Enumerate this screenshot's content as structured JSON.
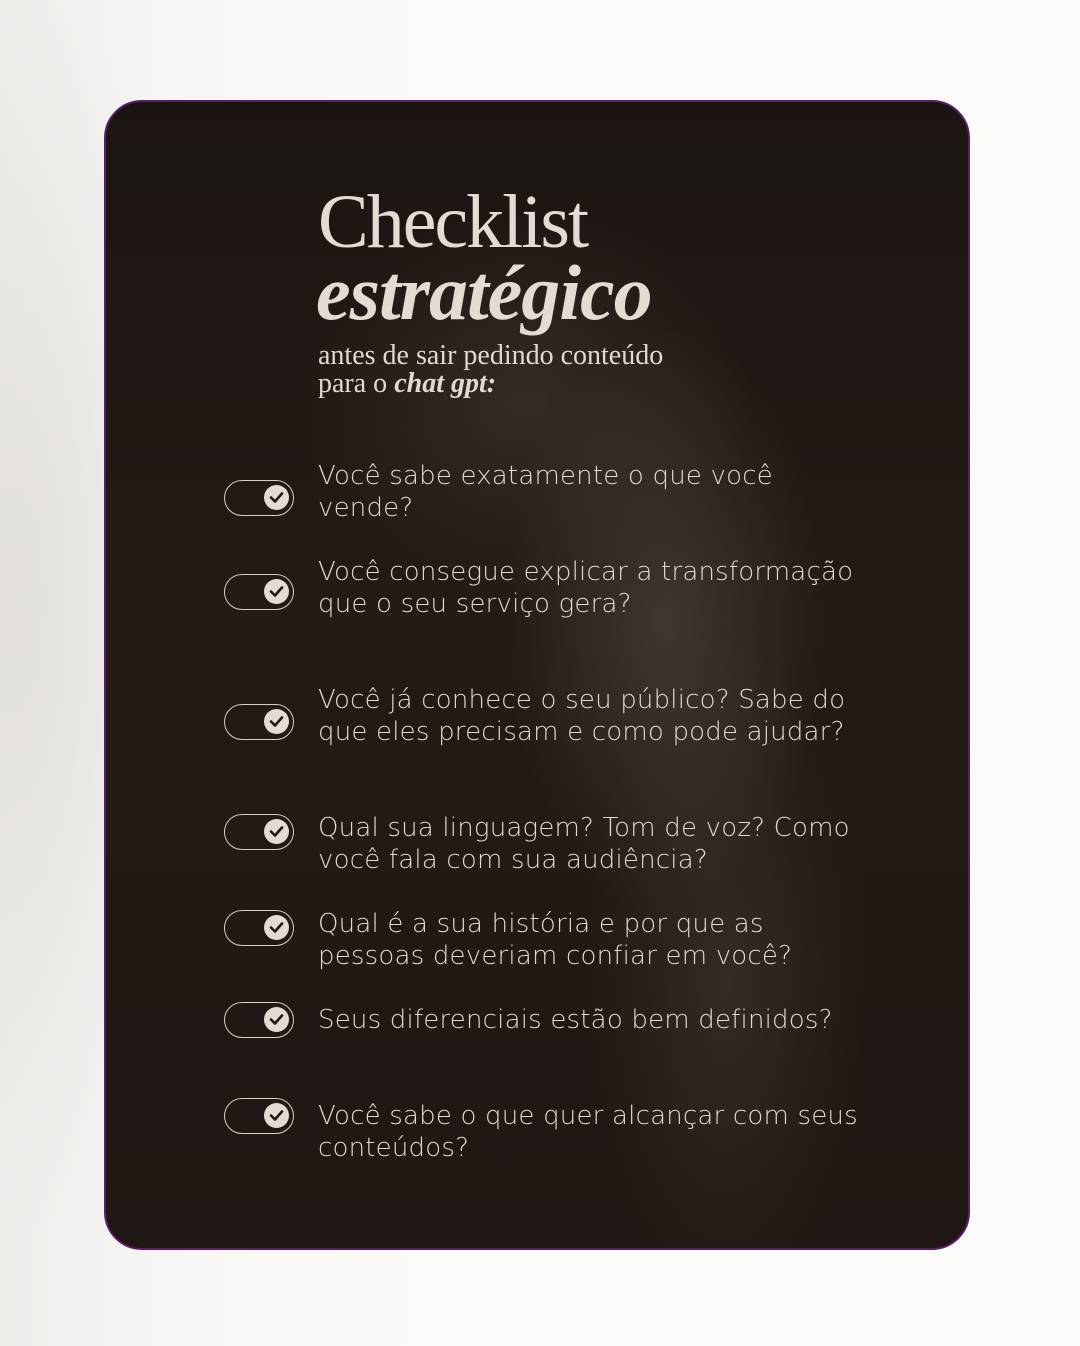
{
  "title": {
    "line1": "Checklist",
    "line2": "estratégico"
  },
  "subtitle": {
    "line1": "antes de sair pedindo conteúdo",
    "line2_prefix": "para o ",
    "line2_emphasis": "chat gpt:"
  },
  "checklist": [
    {
      "text": "Você sabe exatamente o que você vende?",
      "checked": true,
      "icon": "check-icon"
    },
    {
      "text": "Você consegue explicar a transformação que o seu serviço gera?",
      "checked": true,
      "icon": "check-icon"
    },
    {
      "text": "Você já conhece o seu público? Sabe do que eles precisam e como pode ajudar?",
      "checked": true,
      "icon": "check-icon"
    },
    {
      "text": "Qual sua linguagem? Tom de voz? Como você fala com sua audiência?",
      "checked": true,
      "icon": "check-icon"
    },
    {
      "text": "Qual é a sua história e por que as pessoas deveriam confiar em você?",
      "checked": true,
      "icon": "check-icon"
    },
    {
      "text": "Seus diferenciais estão bem definidos?",
      "checked": true,
      "icon": "check-icon"
    },
    {
      "text": "Você sabe o que quer alcançar com seus conteúdos?",
      "checked": true,
      "icon": "check-icon"
    }
  ],
  "colors": {
    "card_border": "#5a1d6a",
    "card_background": "#1f1814",
    "text": "#e2d9d0"
  }
}
